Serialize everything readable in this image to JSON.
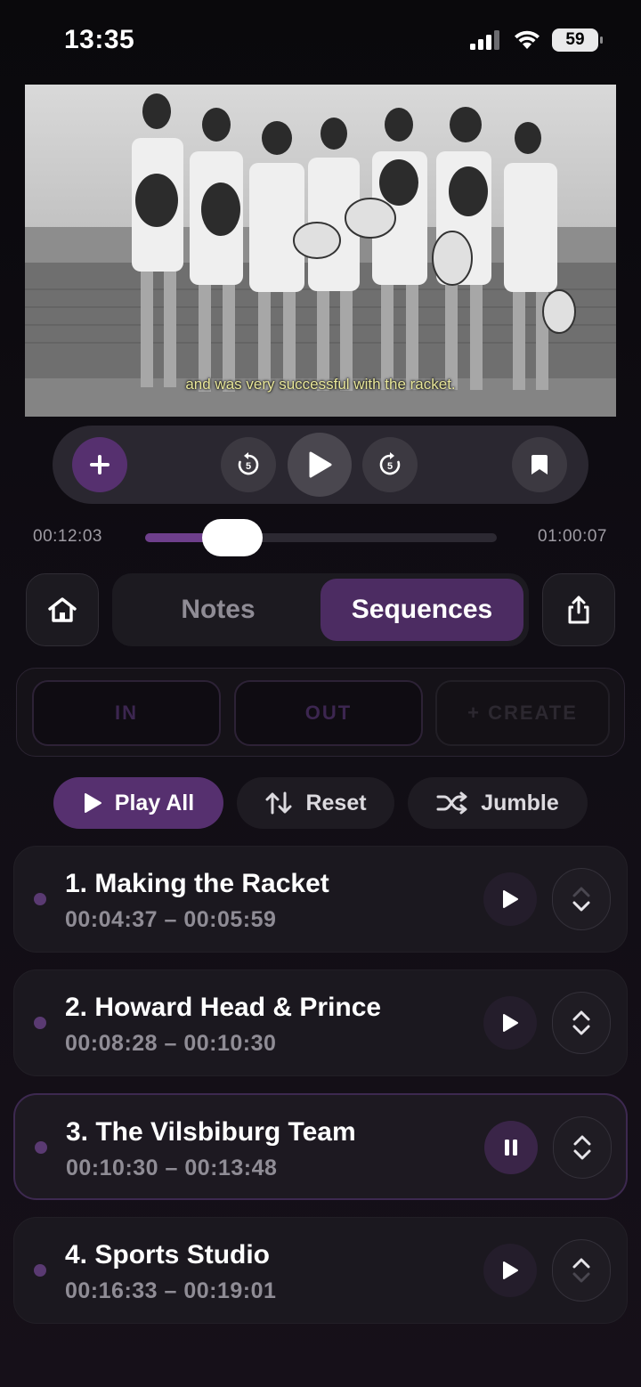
{
  "status": {
    "time": "13:35",
    "battery": "59"
  },
  "video": {
    "subtitle": "and was very successful with the racket."
  },
  "player": {
    "current_time": "00:12:03",
    "end_time": "01:00:07",
    "progress": 0.247,
    "skip_back_seconds": "5",
    "skip_forward_seconds": "5"
  },
  "tabs": {
    "notes": "Notes",
    "sequences": "Sequences",
    "active": "Sequences"
  },
  "marker": {
    "in": "IN",
    "out": "OUT",
    "create": "+ CREATE"
  },
  "actions": {
    "play_all": "Play All",
    "reset": "Reset",
    "jumble": "Jumble"
  },
  "sequences": [
    {
      "title": "1. Making the Racket",
      "range": "00:04:37 – 00:05:59",
      "state": "play",
      "up_enabled": false,
      "down_enabled": true
    },
    {
      "title": "2. Howard Head & Prince",
      "range": "00:08:28 – 00:10:30",
      "state": "play",
      "up_enabled": true,
      "down_enabled": true
    },
    {
      "title": "3. The Vilsbiburg Team",
      "range": "00:10:30 – 00:13:48",
      "state": "pause",
      "up_enabled": true,
      "down_enabled": true
    },
    {
      "title": "4. Sports Studio",
      "range": "00:16:33 – 00:19:01",
      "state": "play",
      "up_enabled": true,
      "down_enabled": false
    }
  ],
  "colors": {
    "accent": "#56306f",
    "accent_dark": "#4c2c62",
    "background": "#0c0a0e"
  }
}
